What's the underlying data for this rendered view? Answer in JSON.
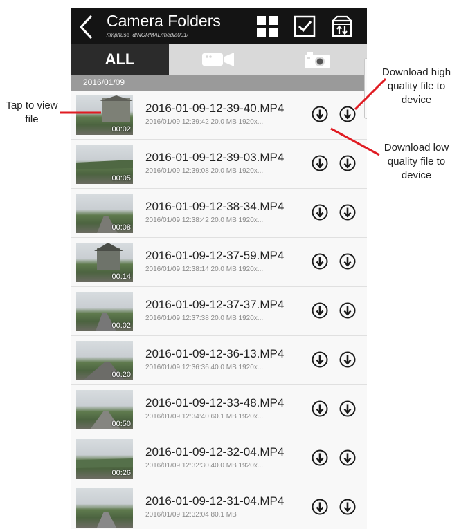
{
  "header": {
    "title": "Camera Folders",
    "path": "/tmp/fuse_d/NORMAL/media001/",
    "icons": [
      "back-icon",
      "grid-icon",
      "checkbox-icon",
      "sort-icon"
    ]
  },
  "tabs": [
    {
      "label": "ALL",
      "icon": "all",
      "selected": true
    },
    {
      "label": "",
      "icon": "video-camera-icon",
      "selected": false
    },
    {
      "label": "",
      "icon": "photo-camera-icon",
      "selected": false
    }
  ],
  "date_group": "2016/01/09",
  "files": [
    {
      "name": "2016-01-09-12-39-40.MP4",
      "meta": "2016/01/09 12:39:42 20.0 MB 1920x...",
      "duration": "00:02"
    },
    {
      "name": "2016-01-09-12-39-03.MP4",
      "meta": "2016/01/09 12:39:08 20.0 MB 1920x...",
      "duration": "00:05"
    },
    {
      "name": "2016-01-09-12-38-34.MP4",
      "meta": "2016/01/09 12:38:42 20.0 MB 1920x...",
      "duration": "00:08"
    },
    {
      "name": "2016-01-09-12-37-59.MP4",
      "meta": "2016/01/09 12:38:14 20.0 MB 1920x...",
      "duration": "00:14"
    },
    {
      "name": "2016-01-09-12-37-37.MP4",
      "meta": "2016/01/09 12:37:38 20.0 MB 1920x...",
      "duration": "00:02"
    },
    {
      "name": "2016-01-09-12-36-13.MP4",
      "meta": "2016/01/09 12:36:36 40.0 MB 1920x...",
      "duration": "00:20"
    },
    {
      "name": "2016-01-09-12-33-48.MP4",
      "meta": "2016/01/09 12:34:40 60.1 MB 1920x...",
      "duration": "00:50"
    },
    {
      "name": "2016-01-09-12-32-04.MP4",
      "meta": "2016/01/09 12:32:30 40.0 MB 1920x...",
      "duration": "00:26"
    },
    {
      "name": "2016-01-09-12-31-04.MP4",
      "meta": "2016/01/09 12:32:04 80.1 MB",
      "duration": ""
    }
  ],
  "annotations": {
    "tap": "Tap to view file",
    "high": "Download high quality file to device",
    "low": "Download low quality file to device"
  },
  "colors": {
    "header": "#141414",
    "tab_selected": "#2b2b2b",
    "callout": "#e01b22"
  }
}
